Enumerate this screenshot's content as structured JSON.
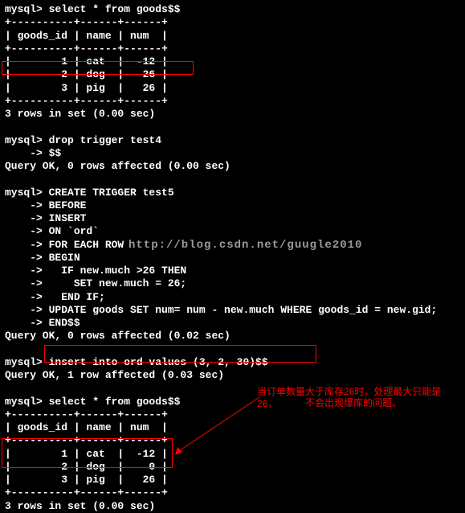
{
  "q1": "select * from goods$$",
  "tbl_border": "+----------+------+------+",
  "tbl_header": "| goods_id | name | num  |",
  "t1": {
    "r1": "|        1 | cat  |  -12 |",
    "r2": "|        2 | dog  |   26 |",
    "r3": "|        3 | pig  |   26 |"
  },
  "msg_3rows": "3 rows in set (0.00 sec)",
  "blank": " ",
  "q2": "drop trigger test4",
  "q2b": "$$",
  "msg_ok0": "Query OK, 0 rows affected (0.00 sec)",
  "q3": {
    "l1": "CREATE TRIGGER test5",
    "l2": "BEFORE",
    "l3": "INSERT",
    "l4": "ON `ord`",
    "l5": "FOR EACH ROW",
    "l6": "BEGIN",
    "l7": "  IF new.much >26 THEN",
    "l8": "    SET new.much = 26;",
    "l9": "  END IF;",
    "l10": "UPDATE goods SET num= num - new.much WHERE goods_id = new.gid;",
    "l11": "END$$"
  },
  "msg_ok002": "Query OK, 0 rows affected (0.02 sec)",
  "q4": "insert into ord values (3, 2, 30)$$",
  "msg_ok1": "Query OK, 1 row affected (0.03 sec)",
  "q5": "select * from goods$$",
  "t2": {
    "r1": "|        1 | cat  |  -12 |",
    "r2": "|        2 | dog  |    0 |",
    "r3": "|        3 | pig  |   26 |"
  },
  "watermark": "http://blog.csdn.net/guugle2010",
  "anno1": "当订单数量大于库存26时，处理最大只能是26，",
  "anno2": "不会出现爆库的问题。"
}
